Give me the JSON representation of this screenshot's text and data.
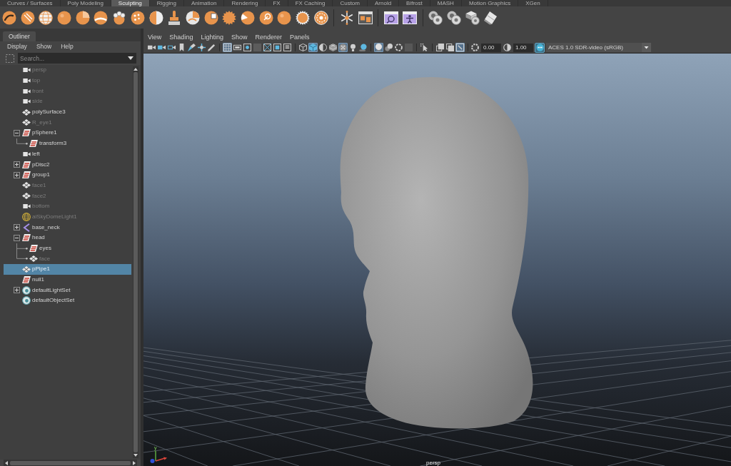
{
  "shelf_tabs": [
    {
      "label": "Curves / Surfaces",
      "selected": false
    },
    {
      "label": "Poly Modeling",
      "selected": false
    },
    {
      "label": "Sculpting",
      "selected": true
    },
    {
      "label": "Rigging",
      "selected": false
    },
    {
      "label": "Animation",
      "selected": false
    },
    {
      "label": "Rendering",
      "selected": false
    },
    {
      "label": "FX",
      "selected": false
    },
    {
      "label": "FX Caching",
      "selected": false
    },
    {
      "label": "Custom",
      "selected": false
    },
    {
      "label": "Arnold",
      "selected": false
    },
    {
      "label": "Bifrost",
      "selected": false
    },
    {
      "label": "MASH",
      "selected": false
    },
    {
      "label": "Motion Graphics",
      "selected": false
    },
    {
      "label": "XGen",
      "selected": false
    }
  ],
  "outliner": {
    "tab": "Outliner",
    "menu": [
      "Display",
      "Show",
      "Help"
    ],
    "search": {
      "placeholder": "Search..."
    },
    "items": [
      {
        "name": "persp",
        "kind": "camera",
        "hidden": true,
        "selected": false
      },
      {
        "name": "top",
        "kind": "camera",
        "hidden": true,
        "selected": false
      },
      {
        "name": "front",
        "kind": "camera",
        "hidden": true,
        "selected": false
      },
      {
        "name": "side",
        "kind": "camera",
        "hidden": true,
        "selected": false
      },
      {
        "name": "polySurface3",
        "kind": "mesh",
        "hidden": false,
        "selected": false
      },
      {
        "name": "R_eye1",
        "kind": "mesh",
        "hidden": true,
        "selected": false
      },
      {
        "name": "pSphere1",
        "kind": "transform",
        "hidden": false,
        "selected": false,
        "expanded": true,
        "children": [
          {
            "name": "transform3",
            "kind": "transform",
            "hidden": false,
            "selected": false
          }
        ]
      },
      {
        "name": "left",
        "kind": "camera",
        "hidden": false,
        "selected": false
      },
      {
        "name": "pDisc2",
        "kind": "transform",
        "hidden": false,
        "selected": false,
        "expanded": false
      },
      {
        "name": "group1",
        "kind": "transform",
        "hidden": false,
        "selected": false,
        "expanded": false
      },
      {
        "name": "face1",
        "kind": "mesh",
        "hidden": true,
        "selected": false
      },
      {
        "name": "face2",
        "kind": "mesh",
        "hidden": true,
        "selected": false
      },
      {
        "name": "bottom",
        "kind": "camera",
        "hidden": true,
        "selected": false
      },
      {
        "name": "aiSkyDomeLight1",
        "kind": "light",
        "hidden": true,
        "selected": false
      },
      {
        "name": "base_neck",
        "kind": "joint",
        "hidden": false,
        "selected": false,
        "expanded": false
      },
      {
        "name": "head",
        "kind": "transform",
        "hidden": false,
        "selected": false,
        "expanded": true,
        "children": [
          {
            "name": "eyes",
            "kind": "transform",
            "hidden": false,
            "selected": false
          },
          {
            "name": "face",
            "kind": "mesh",
            "hidden": true,
            "selected": false
          }
        ]
      },
      {
        "name": "pPipe1",
        "kind": "mesh",
        "hidden": false,
        "selected": true
      },
      {
        "name": "null1",
        "kind": "transform",
        "hidden": false,
        "selected": false
      },
      {
        "name": "defaultLightSet",
        "kind": "set",
        "hidden": false,
        "selected": false,
        "expanded": false
      },
      {
        "name": "defaultObjectSet",
        "kind": "set",
        "hidden": false,
        "selected": false
      }
    ]
  },
  "viewport": {
    "menu": [
      "View",
      "Shading",
      "Lighting",
      "Show",
      "Renderer",
      "Panels"
    ],
    "toolbar_groups": [
      {
        "buttons": [
          {
            "kind": "camera",
            "on": false
          },
          {
            "kind": "camera-lock",
            "on": false
          },
          {
            "kind": "camera-attributes",
            "on": false
          },
          {
            "kind": "bookmark",
            "on": false
          },
          {
            "kind": "image-plane",
            "on": false
          },
          {
            "kind": "pan-zoom",
            "on": false
          },
          {
            "kind": "grease-pencil",
            "on": false
          }
        ]
      },
      {
        "buttons": [
          {
            "kind": "grid",
            "on": true
          },
          {
            "kind": "film-gate",
            "on": false
          },
          {
            "kind": "resolution-gate",
            "on": false
          },
          {
            "kind": "gate-mask",
            "on": false
          },
          {
            "kind": "field-chart",
            "on": false
          },
          {
            "kind": "safe-action",
            "on": false
          },
          {
            "kind": "safe-title",
            "on": false
          }
        ]
      },
      {
        "buttons": [
          {
            "kind": "wireframe",
            "on": false
          },
          {
            "kind": "smooth-shade",
            "on": true
          },
          {
            "kind": "default-material",
            "on": false
          },
          {
            "kind": "textured",
            "on": false
          },
          {
            "kind": "xray",
            "on": true
          },
          {
            "kind": "lights",
            "on": false
          },
          {
            "kind": "shadows",
            "on": false
          }
        ]
      },
      {
        "buttons": [
          {
            "kind": "ambient-occlusion",
            "on": true
          },
          {
            "kind": "motion-blur",
            "on": false
          },
          {
            "kind": "anti-aliasing",
            "on": false
          },
          {
            "kind": "depth-of-field",
            "on": false
          }
        ]
      },
      {
        "buttons": [
          {
            "kind": "select",
            "on": false
          }
        ]
      },
      {
        "buttons": [
          {
            "kind": "isolate",
            "on": false
          },
          {
            "kind": "xray-joints",
            "on": false
          },
          {
            "kind": "xray-active",
            "on": true
          }
        ]
      }
    ],
    "exposure": "0.00",
    "gamma": "1.00",
    "color_management": {
      "on": true,
      "color_space": "ACES 1.0 SDR-video (sRGB)"
    },
    "axis_label": "y",
    "camera_label": "persp"
  }
}
